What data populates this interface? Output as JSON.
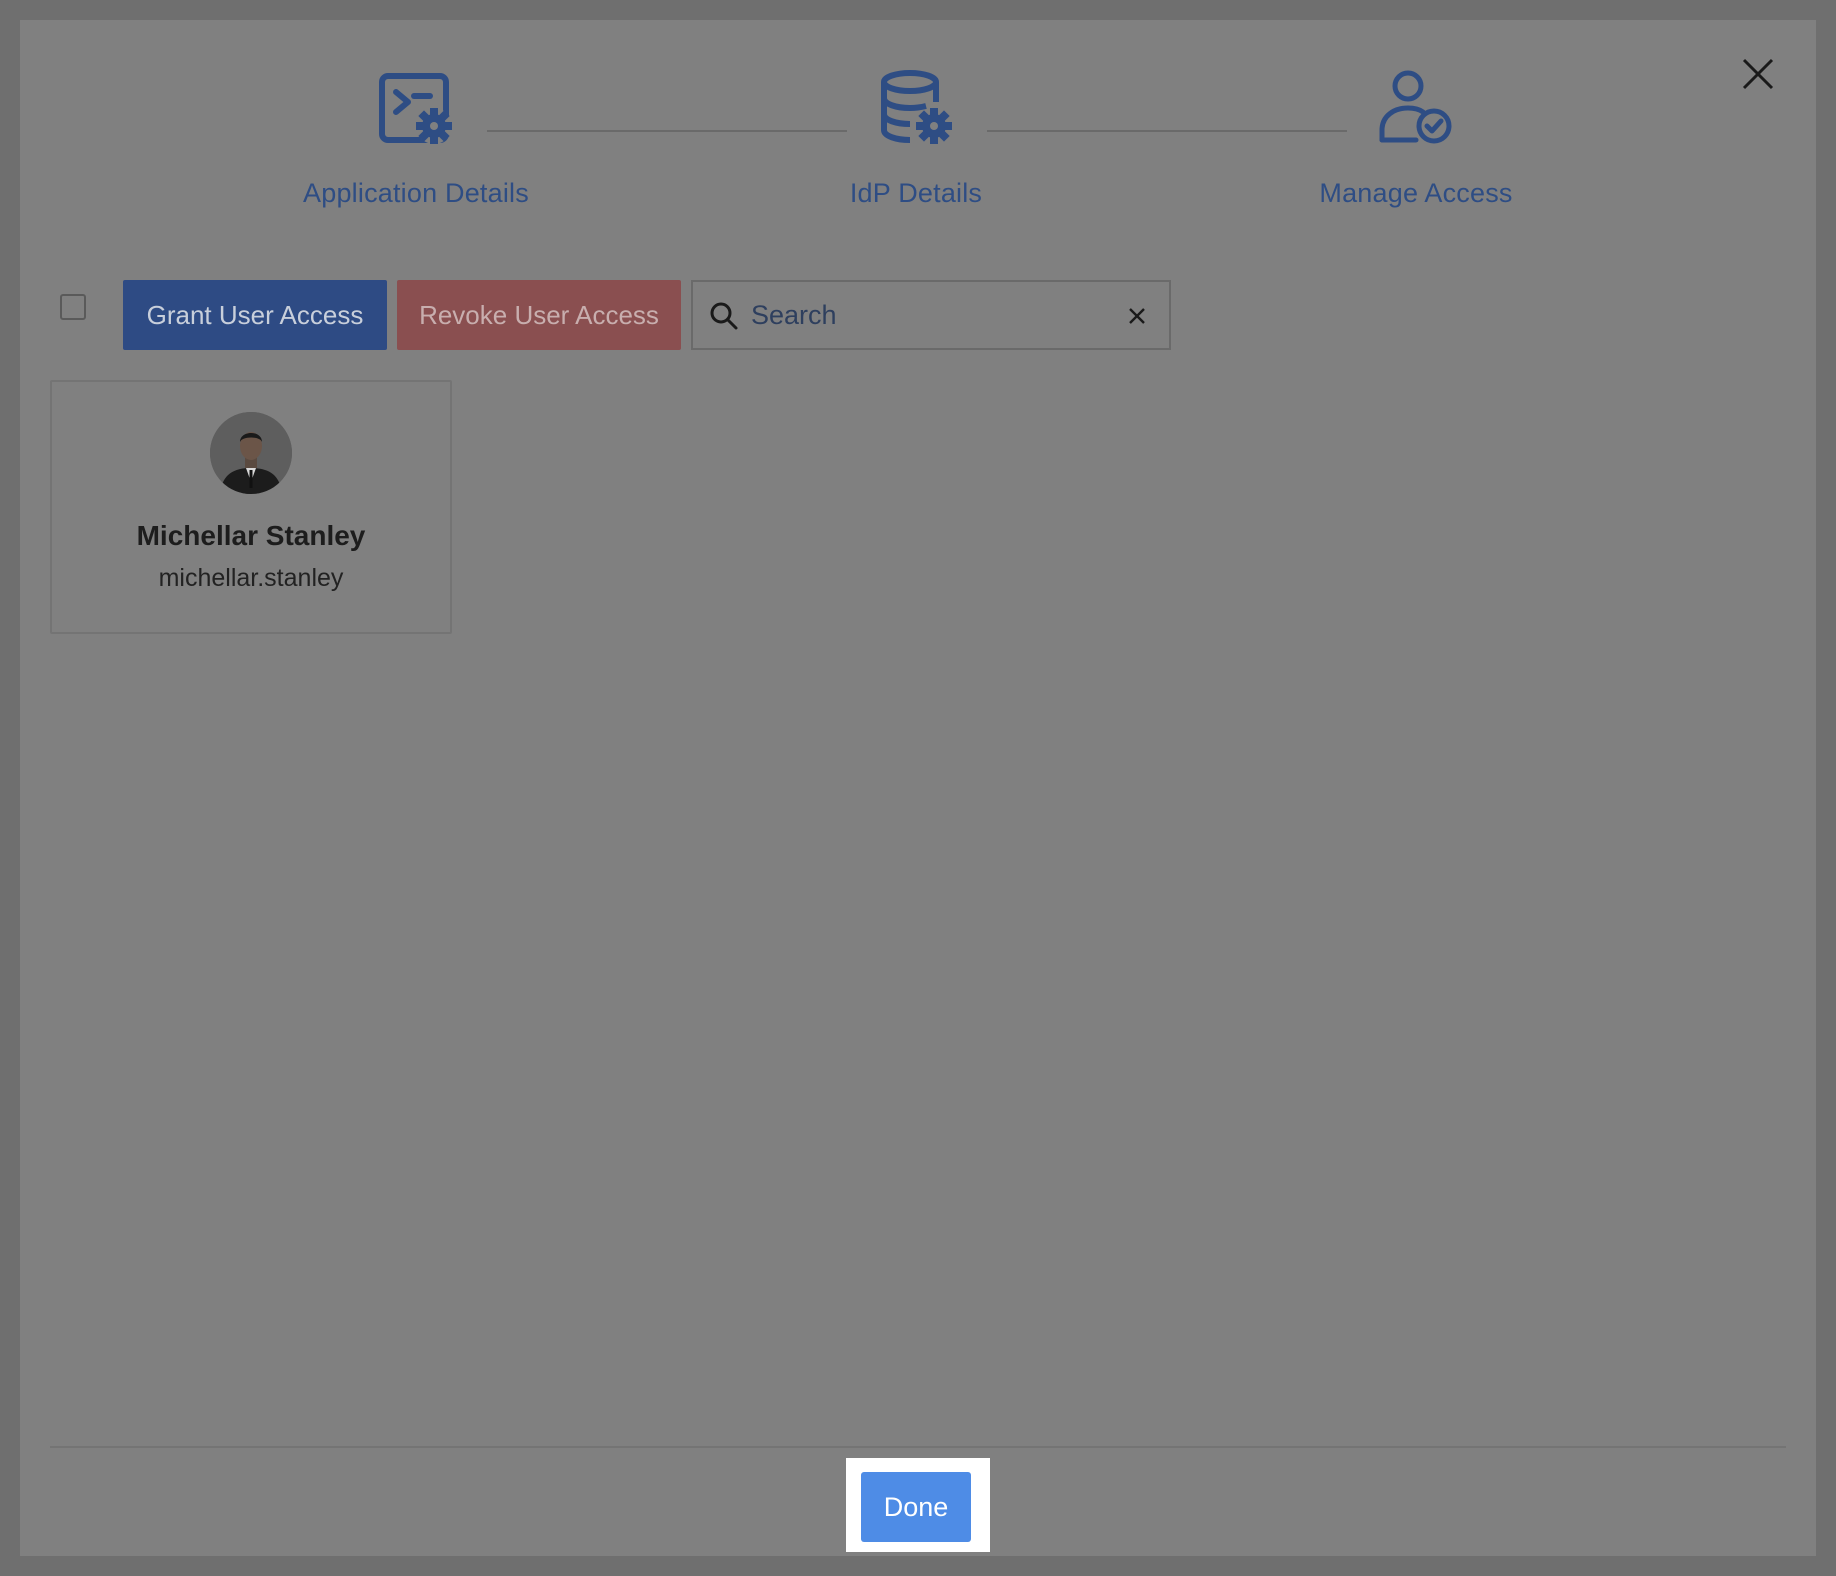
{
  "steps": [
    {
      "label": "Application Details",
      "icon": "application-settings-icon"
    },
    {
      "label": "IdP Details",
      "icon": "database-settings-icon"
    },
    {
      "label": "Manage Access",
      "icon": "user-check-icon"
    }
  ],
  "toolbar": {
    "grant_label": "Grant User Access",
    "revoke_label": "Revoke User Access",
    "search_placeholder": "Search"
  },
  "users": [
    {
      "name": "Michellar Stanley",
      "username": "michellar.stanley"
    }
  ],
  "footer": {
    "done_label": "Done"
  },
  "colors": {
    "accent": "#2e4b84",
    "danger": "#8a4f50",
    "primary": "#4e8ce6",
    "step_label": "#2e4d84"
  }
}
